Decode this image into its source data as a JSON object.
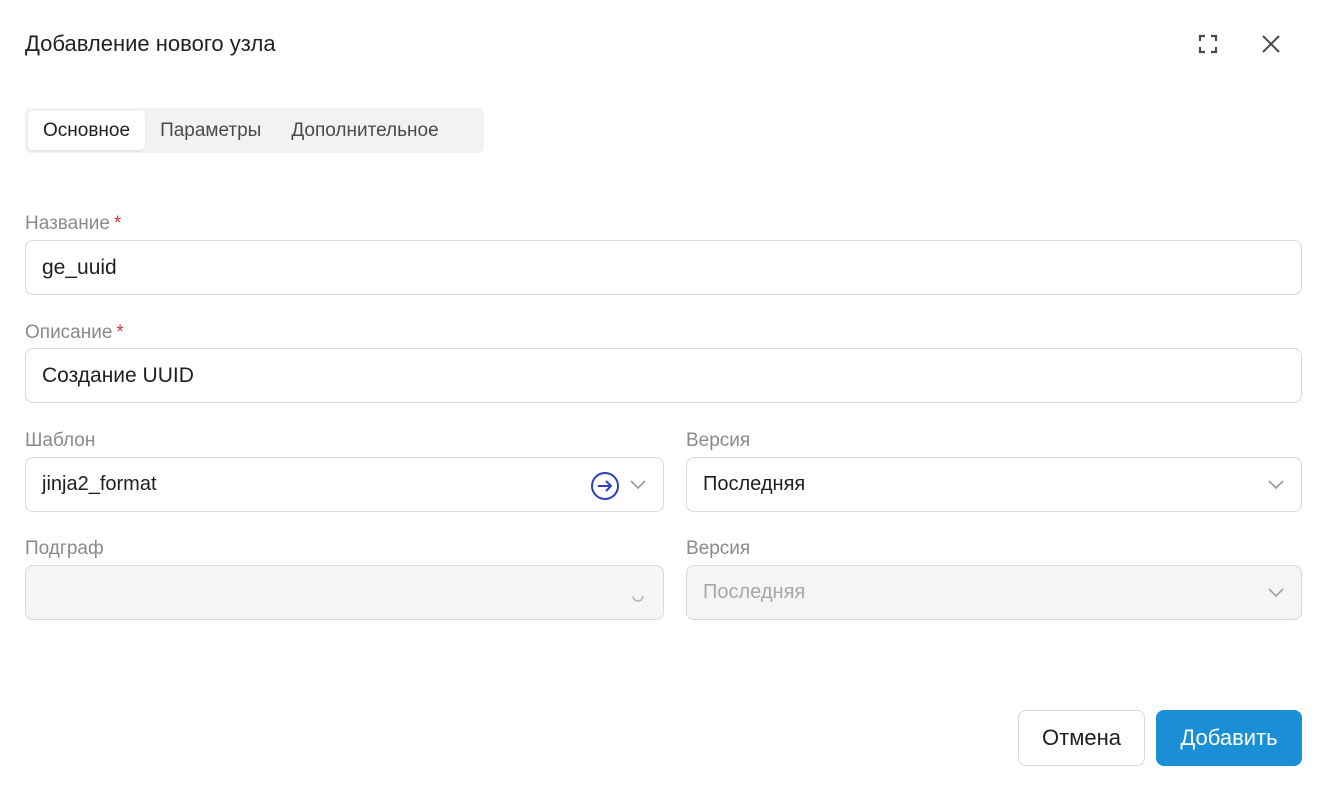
{
  "dialog": {
    "title": "Добавление нового узла"
  },
  "tabs": [
    {
      "label": "Основное",
      "active": true
    },
    {
      "label": "Параметры",
      "active": false
    },
    {
      "label": "Дополнительное",
      "active": false
    }
  ],
  "form": {
    "name": {
      "label": "Название",
      "required_mark": "*",
      "value": "ge_uuid"
    },
    "description": {
      "label": "Описание",
      "required_mark": "*",
      "value": "Создание UUID"
    },
    "template": {
      "label": "Шаблон",
      "value": "jinja2_format"
    },
    "template_version": {
      "label": "Версия",
      "value": "Последняя"
    },
    "subgraph": {
      "label": "Подграф",
      "value": ""
    },
    "subgraph_version": {
      "label": "Версия",
      "value": "Последняя"
    }
  },
  "buttons": {
    "cancel_label": "Отмена",
    "add_label": "Добавить"
  },
  "colors": {
    "accent": "#1a8fd6",
    "required": "#e0383e",
    "link_icon": "#2d3fbd"
  },
  "icons": {
    "expand": "expand-icon",
    "close": "close-icon",
    "goto": "arrow-right-circle-icon",
    "chevron": "chevron-down-icon",
    "loading": "spinner-icon"
  }
}
